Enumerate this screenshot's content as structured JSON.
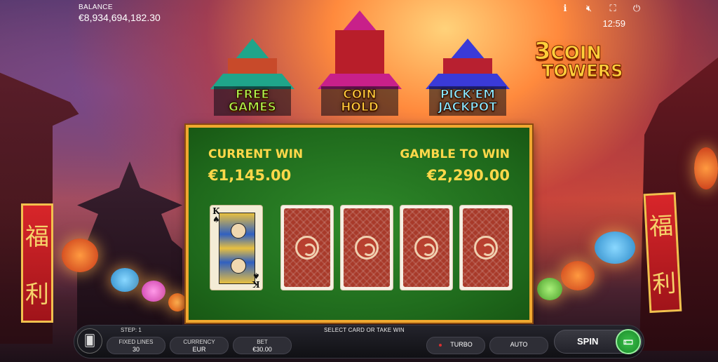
{
  "header": {
    "balance_label": "BALANCE",
    "balance_value": "€8,934,694,182.30",
    "time": "12:59",
    "icons": [
      "info-icon",
      "mute-icon",
      "fullscreen-icon",
      "power-icon"
    ]
  },
  "towers": [
    {
      "label_line1": "FREE",
      "label_line2": "GAMES"
    },
    {
      "label_line1": "COIN",
      "label_line2": "HOLD"
    },
    {
      "label_line1": "PICK'EM",
      "label_line2": "JACKPOT"
    }
  ],
  "logo": {
    "number": "3",
    "word1": "COIN",
    "word2": "TOWERS"
  },
  "gamble": {
    "current_win_label": "CURRENT WIN",
    "current_win_value": "€1,145.00",
    "gamble_label": "GAMBLE TO WIN",
    "gamble_value": "€2,290.00",
    "revealed_card": {
      "rank": "K",
      "suit": "♠"
    }
  },
  "banners": [
    "福",
    "利"
  ],
  "bottom_bar": {
    "step": "STEP: 1",
    "hint": "SELECT CARD OR TAKE WIN",
    "fixed_lines_label": "FIXED LINES",
    "fixed_lines_value": "30",
    "currency_label": "CURRENCY",
    "currency_value": "EUR",
    "bet_label": "BET",
    "bet_value": "€30.00",
    "turbo_label": "TURBO",
    "auto_label": "AUTO",
    "spin_label": "SPIN"
  },
  "colors": {
    "panel_green": "#1f6a1c",
    "panel_border": "#f0a830",
    "gold_text": "#ffd84a",
    "card_back": "#a83a2a"
  }
}
